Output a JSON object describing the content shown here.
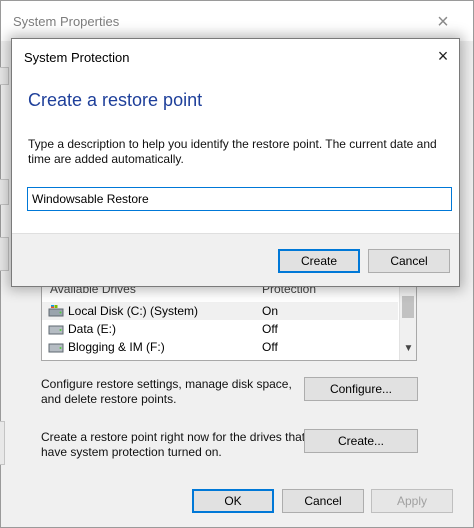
{
  "background_window": {
    "title": "System Properties",
    "close_icon": "×",
    "drives": {
      "header_col1": "Available Drives",
      "header_col2": "Protection",
      "rows": [
        {
          "name": "Local Disk (C:) (System)",
          "protection": "On",
          "icon": "system-drive-icon"
        },
        {
          "name": "Data (E:)",
          "protection": "Off",
          "icon": "drive-icon"
        },
        {
          "name": "Blogging & IM (F:)",
          "protection": "Off",
          "icon": "drive-icon"
        }
      ]
    },
    "configure": {
      "text_line1": "Configure restore settings, manage disk space,",
      "text_line2": "and delete restore points.",
      "button_label": "Configure..."
    },
    "create": {
      "text_line1": "Create a restore point right now for the drives that",
      "text_line2": "have system protection turned on.",
      "button_label": "Create..."
    },
    "footer": {
      "ok_label": "OK",
      "cancel_label": "Cancel",
      "apply_label": "Apply"
    }
  },
  "dialog": {
    "title": "System Protection",
    "close_icon": "×",
    "heading": "Create a restore point",
    "description_line1": "Type a description to help you identify the restore point. The current date and",
    "description_line2": "time are added automatically.",
    "input_value": "Windowsable Restore",
    "create_label": "Create",
    "cancel_label": "Cancel"
  },
  "colors": {
    "heading": "#1e3f9a",
    "accent": "#0078d7"
  }
}
